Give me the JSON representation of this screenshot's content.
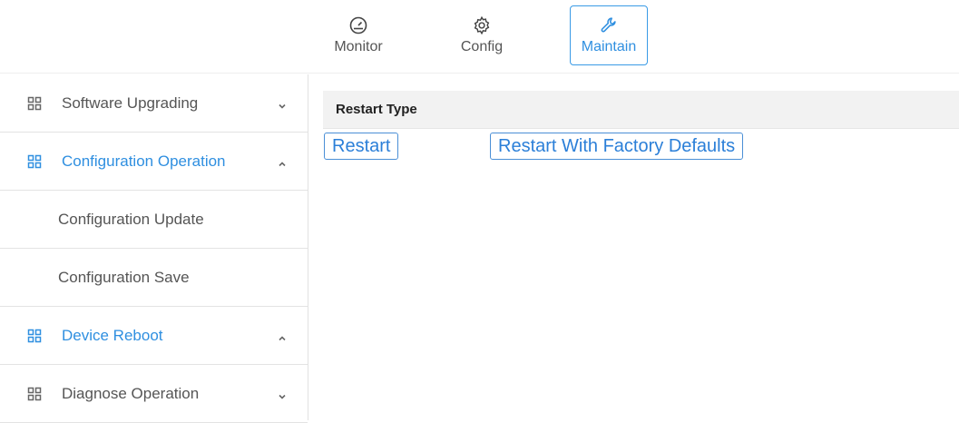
{
  "topnav": {
    "items": [
      {
        "label": "Monitor",
        "icon": "gauge-icon",
        "active": false
      },
      {
        "label": "Config",
        "icon": "gear-icon",
        "active": false
      },
      {
        "label": "Maintain",
        "icon": "wrench-icon",
        "active": true
      }
    ]
  },
  "sidebar": {
    "items": [
      {
        "label": "Software Upgrading",
        "type": "parent",
        "expanded": false,
        "active": false
      },
      {
        "label": "Configuration Operation",
        "type": "parent",
        "expanded": true,
        "active": true
      },
      {
        "label": "Configuration Update",
        "type": "child"
      },
      {
        "label": "Configuration Save",
        "type": "child"
      },
      {
        "label": "Device Reboot",
        "type": "parent",
        "expanded": true,
        "active": true
      },
      {
        "label": "Diagnose Operation",
        "type": "parent",
        "expanded": false,
        "active": false
      }
    ]
  },
  "main": {
    "section_title": "Restart Type",
    "buttons": {
      "restart": "Restart",
      "restart_factory": "Restart With Factory Defaults"
    }
  },
  "colors": {
    "accent": "#2f8fe0",
    "border": "#e3e3e3",
    "header_bg": "#f2f2f2"
  }
}
